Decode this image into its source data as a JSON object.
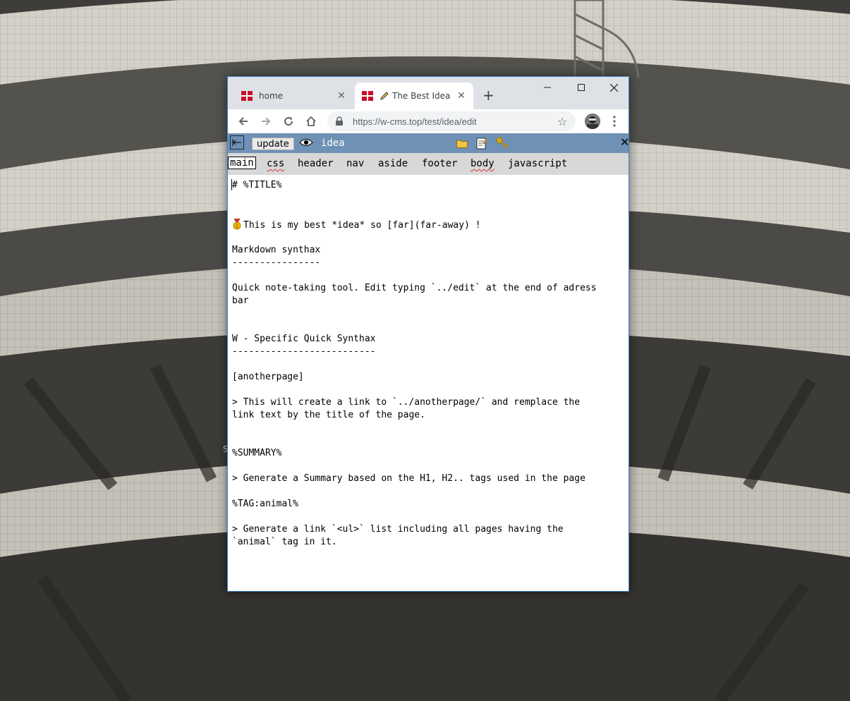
{
  "browser": {
    "tabs": [
      {
        "label": "home",
        "active": false
      },
      {
        "label": "The Best Idea",
        "active": true
      }
    ],
    "new_tab_label": "+",
    "address": "https://w-cms.top/test/idea/edit"
  },
  "cms": {
    "update_label": "update",
    "page_name": "idea",
    "tabs": [
      "main",
      "css",
      "header",
      "nav",
      "aside",
      "footer",
      "body",
      "javascript"
    ],
    "active_tab": "main",
    "content_lines": [
      "# %TITLE%",
      "This is my best *idea* so [far](far-away) !",
      "Markdown synthax",
      "----------------",
      "Quick note-taking tool. Edit typing `../edit` at the end of adress",
      "bar",
      "W - Specific Quick Synthax",
      "--------------------------",
      "[anotherpage]",
      "> This will create a link to `../anotherpage/` and remplace the",
      "link text by the title of the page.",
      "%SUMMARY%",
      "> Generate a Summary based on the H1, H2.. tags used in the page",
      "%TAG:animal%",
      "> Generate a link `<ul>` list including all pages having the",
      "`animal` tag in it."
    ]
  },
  "desktop": {
    "stray_char": "S"
  },
  "colors": {
    "cms_bar": "#6e91b5",
    "cms_tabs_bg": "#d8d8d8",
    "tabstrip": "#dee1e6",
    "window_border": "#3c84c8"
  }
}
